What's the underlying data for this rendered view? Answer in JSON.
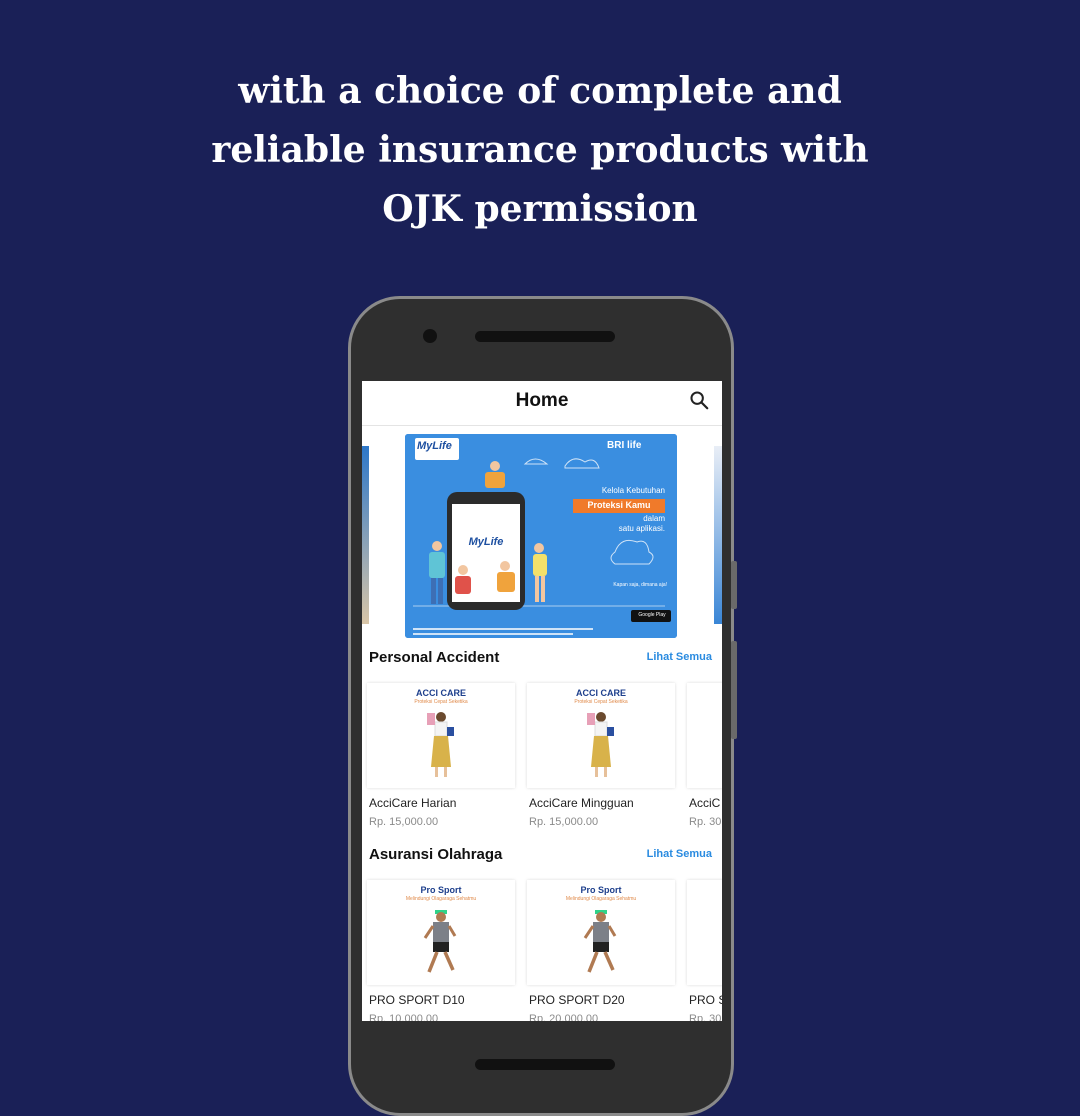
{
  "headline": {
    "line1": "with a choice of complete and",
    "line2": "reliable insurance products with",
    "line3": "OJK permission"
  },
  "app": {
    "title": "Home",
    "search_icon": "search-icon"
  },
  "banner": {
    "brand_logo": "MyLife",
    "company_logo": "BRI life",
    "phone_logo": "MyLife",
    "text1": "Kelola Kebutuhan",
    "highlight": "Proteksi Kamu",
    "text2": "dalam",
    "text3": "satu aplikasi.",
    "tagline": "Kapan saja, dimana aja!",
    "store_badge": "Google Play",
    "colors": {
      "background": "#3a8ee0",
      "highlight": "#f07a2a"
    }
  },
  "sections": [
    {
      "title": "Personal Accident",
      "link": "Lihat Semua",
      "cards": [
        {
          "img_label": "ACCI CARE",
          "img_sub": "Proteksi Cepat Seketika",
          "name": "AcciCare Harian",
          "price": "Rp. 15,000.00"
        },
        {
          "img_label": "ACCI CARE",
          "img_sub": "Proteksi Cepat Seketika",
          "name": "AcciCare Mingguan",
          "price": "Rp. 15,000.00"
        },
        {
          "img_label": "",
          "img_sub": "",
          "name": "AcciC",
          "price": "Rp. 30"
        }
      ]
    },
    {
      "title": "Asuransi Olahraga",
      "link": "Lihat Semua",
      "cards": [
        {
          "img_label": "Pro Sport",
          "img_sub": "Melindungi Olagaraga Sehatmu",
          "name": "PRO SPORT D10",
          "price": "Rp. 10,000.00"
        },
        {
          "img_label": "Pro Sport",
          "img_sub": "Melindungi Olagaraga Sehatmu",
          "name": "PRO SPORT D20",
          "price": "Rp. 20,000.00"
        },
        {
          "img_label": "",
          "img_sub": "",
          "name": "PRO S",
          "price": "Rp. 30"
        }
      ]
    }
  ],
  "colors": {
    "page_bg": "#1a2057",
    "accent_link": "#2a8be0",
    "phone_body": "#2f2f2f"
  }
}
